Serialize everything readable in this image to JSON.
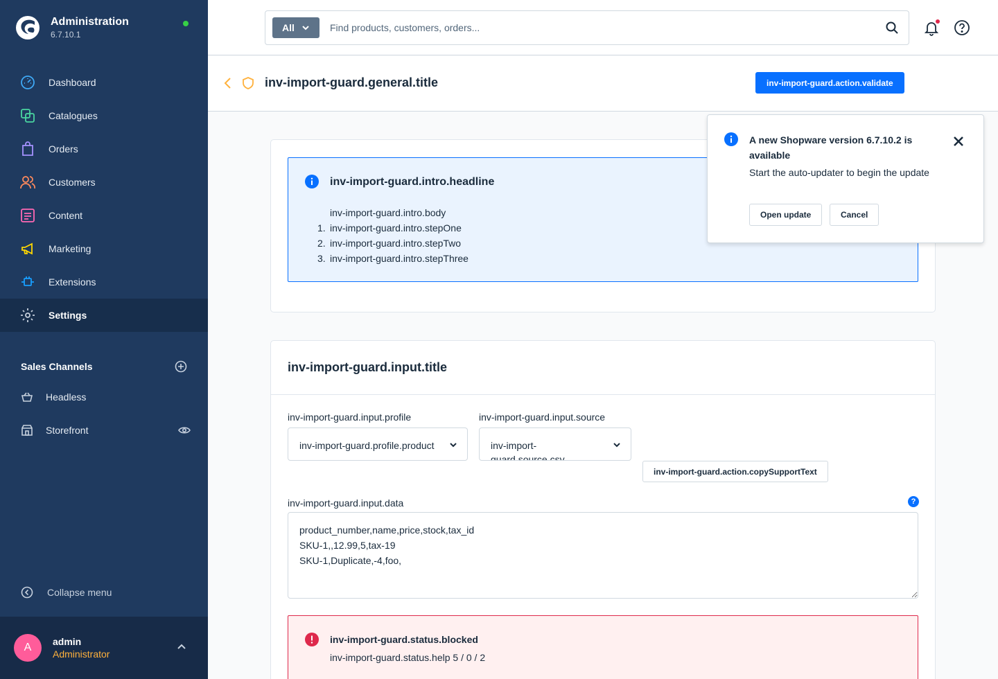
{
  "brand": {
    "title": "Administration",
    "version": "6.7.10.1"
  },
  "nav": [
    {
      "label": "Dashboard",
      "icon": "dashboard-icon",
      "color": "#3fa9f5"
    },
    {
      "label": "Catalogues",
      "icon": "catalogues-icon",
      "color": "#4ad6a0"
    },
    {
      "label": "Orders",
      "icon": "orders-icon",
      "color": "#a592ff"
    },
    {
      "label": "Customers",
      "icon": "customers-icon",
      "color": "#ff8a5c"
    },
    {
      "label": "Content",
      "icon": "content-icon",
      "color": "#ff68b4"
    },
    {
      "label": "Marketing",
      "icon": "marketing-icon",
      "color": "#ffd700"
    },
    {
      "label": "Extensions",
      "icon": "extensions-icon",
      "color": "#189eff"
    },
    {
      "label": "Settings",
      "icon": "gear-icon",
      "color": "#c7d1de",
      "active": true
    }
  ],
  "sales_channels": {
    "header": "Sales Channels",
    "items": [
      {
        "label": "Headless",
        "icon": "basket-icon"
      },
      {
        "label": "Storefront",
        "icon": "storefront-icon"
      }
    ]
  },
  "collapse_label": "Collapse menu",
  "user": {
    "initial": "A",
    "name": "admin",
    "role": "Administrator"
  },
  "search": {
    "type_label": "All",
    "placeholder": "Find products, customers, orders..."
  },
  "smartbar": {
    "title": "inv-import-guard.general.title",
    "validate_label": "inv-import-guard.action.validate"
  },
  "intro": {
    "headline": "inv-import-guard.intro.headline",
    "body": "inv-import-guard.intro.body",
    "steps": [
      {
        "num": "1.",
        "text": "inv-import-guard.intro.stepOne"
      },
      {
        "num": "2.",
        "text": "inv-import-guard.intro.stepTwo"
      },
      {
        "num": "3.",
        "text": "inv-import-guard.intro.stepThree"
      }
    ]
  },
  "input": {
    "title": "inv-import-guard.input.title",
    "profile_label": "inv-import-guard.input.profile",
    "profile_value": "inv-import-guard.profile.product",
    "source_label": "inv-import-guard.input.source",
    "source_value": "inv-import-guard.source.csv",
    "copy_label": "inv-import-guard.action.copySupportText",
    "data_label": "inv-import-guard.input.data",
    "help_glyph": "?",
    "data_value": "product_number,name,price,stock,tax_id\nSKU-1,,12.99,5,tax-19\nSKU-1,Duplicate,-4,foo,"
  },
  "status": {
    "title": "inv-import-guard.status.blocked",
    "help": "inv-import-guard.status.help 5 / 0 / 2"
  },
  "notification": {
    "title": "A new Shopware version 6.7.10.2 is available",
    "body": "Start the auto-updater to begin the update",
    "open_label": "Open update",
    "cancel_label": "Cancel"
  },
  "colors": {
    "sidebar": "#1f3a5f",
    "primary": "#0870ff",
    "danger": "#de294c",
    "role": "#ffb13c"
  }
}
